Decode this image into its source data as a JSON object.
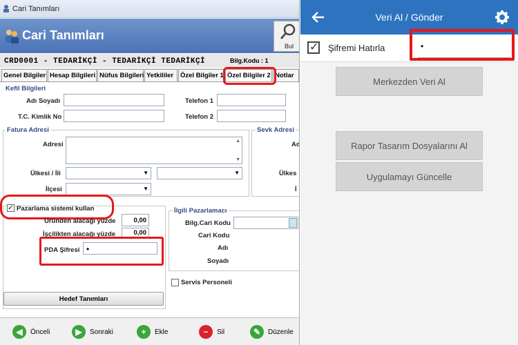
{
  "left": {
    "window_title": "Cari Tanımları",
    "header_title": "Cari Tanımları",
    "bul_button": "Bul",
    "cari_code": "CRD0001 - TEDARİKÇİ - TEDARİKÇİ TEDARİKÇİ",
    "bilg_kodu": "Bilg.Kodu : 1",
    "tabs": [
      "Genel Bilgiler",
      "Hesap Bilgileri",
      "Nüfus Bilgileri",
      "Yetkililer",
      "Özel Bilgiler 1",
      "Özel Bilgiler 2",
      "Notlar"
    ],
    "kefil": {
      "title": "Kefil Bilgileri",
      "adi_soyadi": "Adı Soyadı",
      "tc": "T.C. Kimlik No",
      "tel1": "Telefon 1",
      "tel2": "Telefon 2"
    },
    "fatura": {
      "title": "Fatura Adresi",
      "adresi": "Adresi",
      "ulkesi": "Ülkesi / İli",
      "ilcesi": "İlçesi"
    },
    "sevk": {
      "title": "Sevk Adresi",
      "a": "Ad",
      "u": "Ülkes",
      "i": "İ"
    },
    "pazarlama": {
      "checkbox_label": "Pazarlama sistemi kullan",
      "checked_mark": "✓",
      "urun_label": "Üründen alacağı yüzde",
      "urun_value": "0,00",
      "iscilik_label": "İşçilikten alacağı yüzde",
      "iscilik_value": "0,00",
      "pda_label": "PDA Şifresi",
      "pda_value": "•"
    },
    "ilgili": {
      "title": "İlgili Pazarlamacı",
      "bilg_cari_kodu": "Bilg.Cari Kodu",
      "cari_kodu": "Cari Kodu",
      "adi": "Adı",
      "soyadi": "Soyadı"
    },
    "servis_personeli": "Servis Personeli",
    "hedef_button": "Hedef Tanımları",
    "bottom": {
      "onceki": "Önceli",
      "sonraki": "Sonraki",
      "ekle": "Ekle",
      "sil": "Sil",
      "duzenle": "Düzenle"
    }
  },
  "right": {
    "title": "Veri Al / Gönder",
    "sifremi_hatirla": "Şifremi Hatırla",
    "password_value": "•",
    "checked_mark": "✓",
    "btn_merkez": "Merkezden Veri Al",
    "btn_rapor": "Rapor Tasarım Dosyalarını Al",
    "btn_guncelle": "Uygulamayı Güncelle"
  },
  "colors": {
    "header_blue": "#4b74b7",
    "android_blue": "#2d73c0",
    "highlight_red": "#e3191a"
  }
}
